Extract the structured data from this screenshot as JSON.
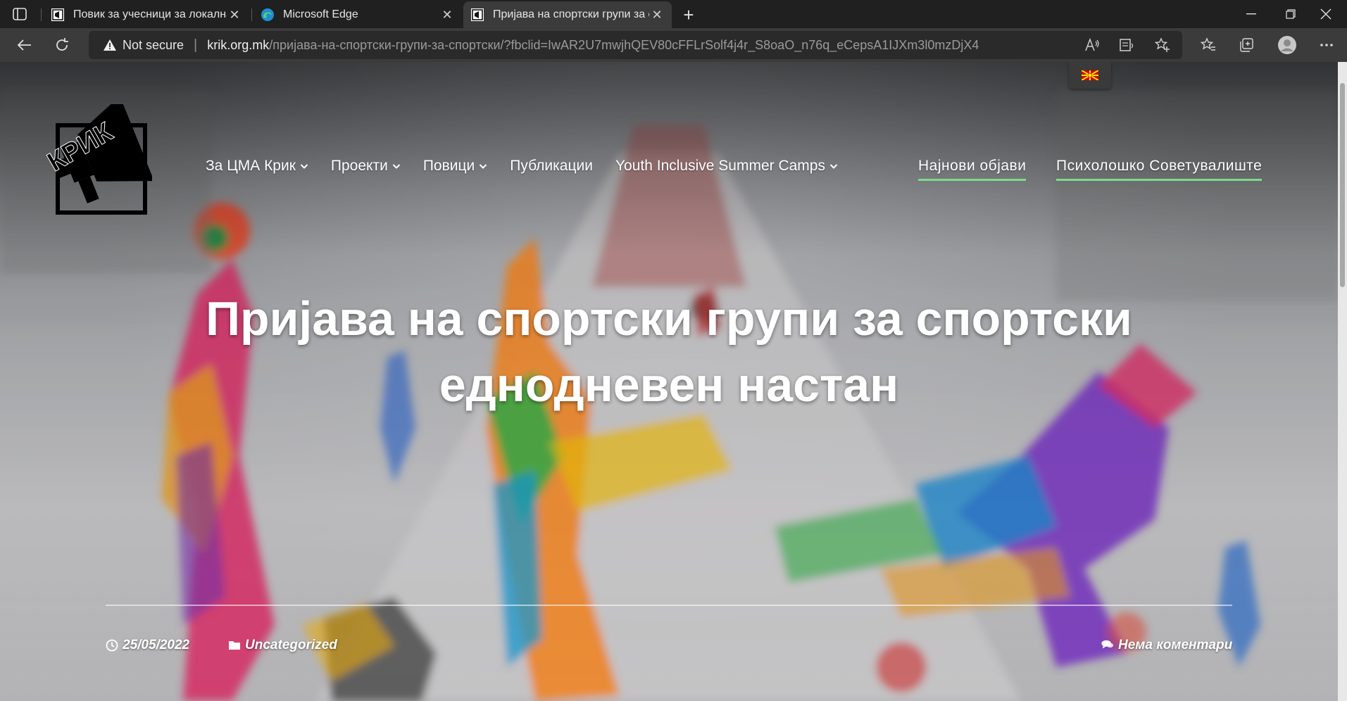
{
  "browser": {
    "tabs": [
      {
        "title": "Повик за учесници за локална",
        "active": false
      },
      {
        "title": "Microsoft Edge",
        "active": false
      },
      {
        "title": "Пријава на спортски групи за с",
        "active": true
      }
    ],
    "address": {
      "security_label": "Not secure",
      "host": "krik.org.mk",
      "path": "/пријава-на-спортски-групи-за-спортски/?fbclid=IwAR2U7mwjhQEV80cFFLrSolf4j4r_S8oaO_n76q_eCepsA1IJXm3l0mzDjX4"
    }
  },
  "site": {
    "logo_text": "КРИК",
    "nav": [
      {
        "label": "За ЦМА Крик",
        "dropdown": true
      },
      {
        "label": "Проекти",
        "dropdown": true
      },
      {
        "label": "Повици",
        "dropdown": true
      },
      {
        "label": "Публикации",
        "dropdown": false
      },
      {
        "label": "Youth Inclusive Summer Camps",
        "dropdown": true
      }
    ],
    "nav_highlight": [
      {
        "label": "Најнови објави"
      },
      {
        "label": "Психолошко Советувалиште"
      }
    ],
    "accent_color": "#7fd98a"
  },
  "post": {
    "title_line1": "Пријава на спортски групи за спортски",
    "title_line2": "еднодневен настан",
    "date": "25/05/2022",
    "category": "Uncategorized",
    "comments": "Нема коментари"
  }
}
